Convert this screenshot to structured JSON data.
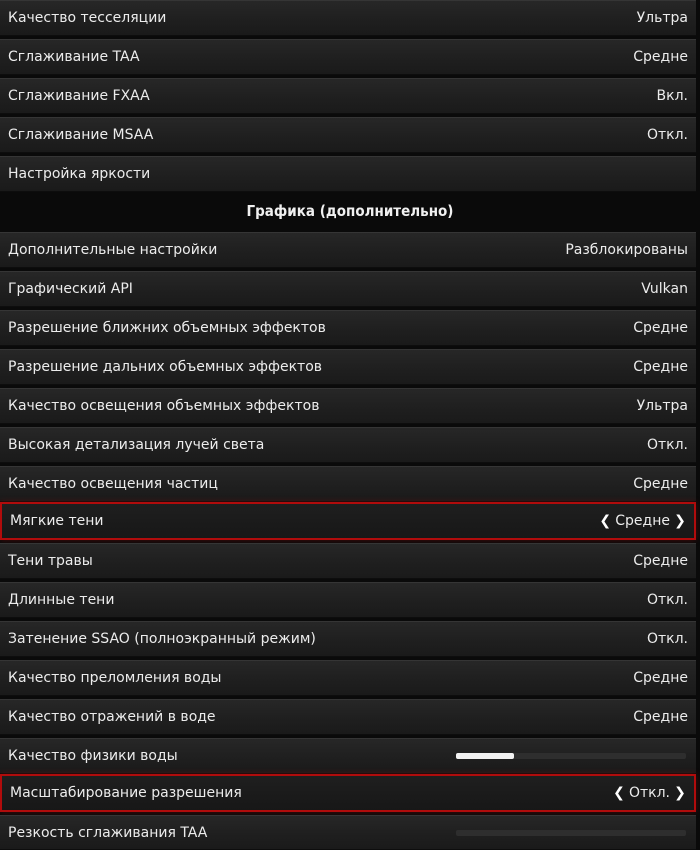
{
  "section": {
    "title": "Графика (дополнительно)"
  },
  "settings": {
    "basic": [
      {
        "label": "Качество тесселяции",
        "value": "Ультра"
      },
      {
        "label": "Сглаживание TAA",
        "value": "Средне"
      },
      {
        "label": "Сглаживание FXAA",
        "value": "Вкл."
      },
      {
        "label": "Сглаживание MSAA",
        "value": "Откл."
      },
      {
        "label": "Настройка яркости",
        "value": ""
      }
    ],
    "advanced": [
      {
        "label": "Дополнительные настройки",
        "value": "Разблокированы"
      },
      {
        "label": "Графический API",
        "value": "Vulkan"
      },
      {
        "label": "Разрешение ближних объемных эффектов",
        "value": "Средне"
      },
      {
        "label": "Разрешение дальних объемных эффектов",
        "value": "Средне"
      },
      {
        "label": "Качество освещения объемных эффектов",
        "value": "Ультра"
      },
      {
        "label": "Высокая детализация лучей света",
        "value": "Откл."
      },
      {
        "label": "Качество освещения частиц",
        "value": "Средне"
      },
      {
        "label": "Мягкие тени",
        "value": "Средне",
        "selected": true
      },
      {
        "label": "Тени травы",
        "value": "Средне"
      },
      {
        "label": "Длинные тени",
        "value": "Откл."
      },
      {
        "label": "Затенение SSAO (полноэкранный режим)",
        "value": "Откл."
      },
      {
        "label": "Качество преломления воды",
        "value": "Средне"
      },
      {
        "label": "Качество отражений в воде",
        "value": "Средне"
      },
      {
        "label": "Качество физики воды",
        "slider_fraction": 0.25
      },
      {
        "label": "Масштабирование разрешения",
        "value": "Откл.",
        "selected": true
      },
      {
        "label": "Резкость сглаживания TAA",
        "slider_fraction": 0
      }
    ]
  },
  "colors": {
    "highlight_border": "#b10c0c",
    "slider_fill": "#f2f2f2"
  },
  "icons": {
    "left_arrow": "❮",
    "right_arrow": "❯"
  }
}
